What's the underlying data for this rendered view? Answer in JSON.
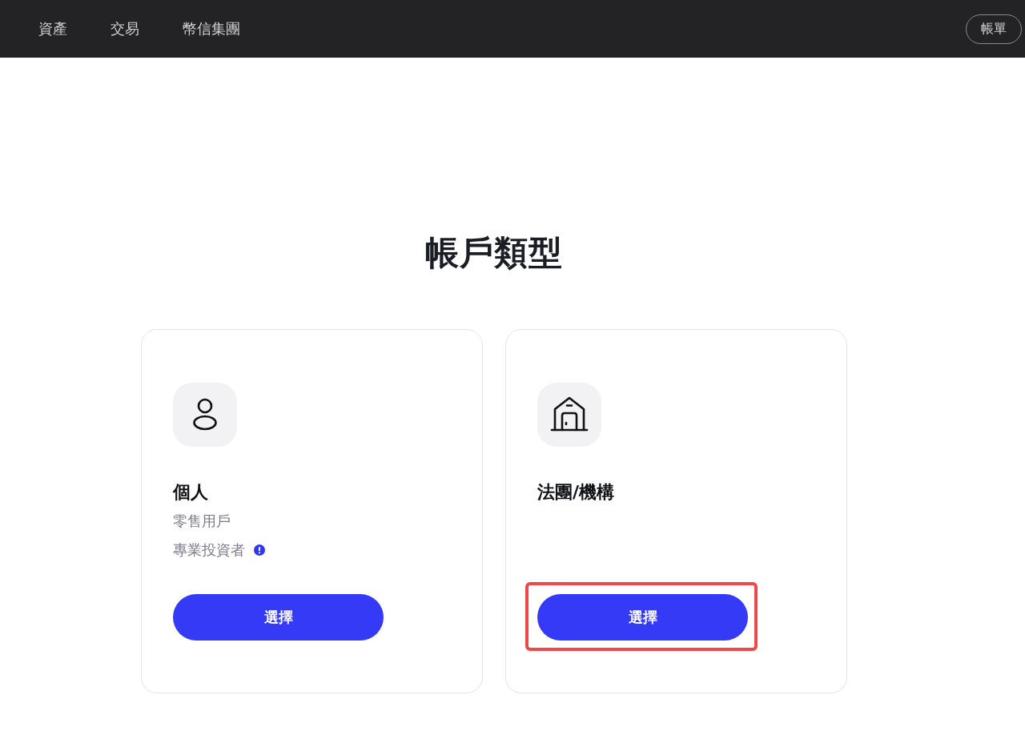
{
  "nav": {
    "items": [
      {
        "label": "資產"
      },
      {
        "label": "交易"
      },
      {
        "label": "幣信集團"
      }
    ],
    "account_button": "帳單"
  },
  "title": "帳戶類型",
  "cards": [
    {
      "kind": "person",
      "title": "個人",
      "lines": [
        {
          "text": "零售用戶",
          "has_info": false
        },
        {
          "text": "專業投資者",
          "has_info": true
        }
      ],
      "button": "選擇",
      "highlighted": false
    },
    {
      "kind": "building",
      "title": "法團/機構",
      "button": "選擇",
      "highlighted": true
    }
  ]
}
